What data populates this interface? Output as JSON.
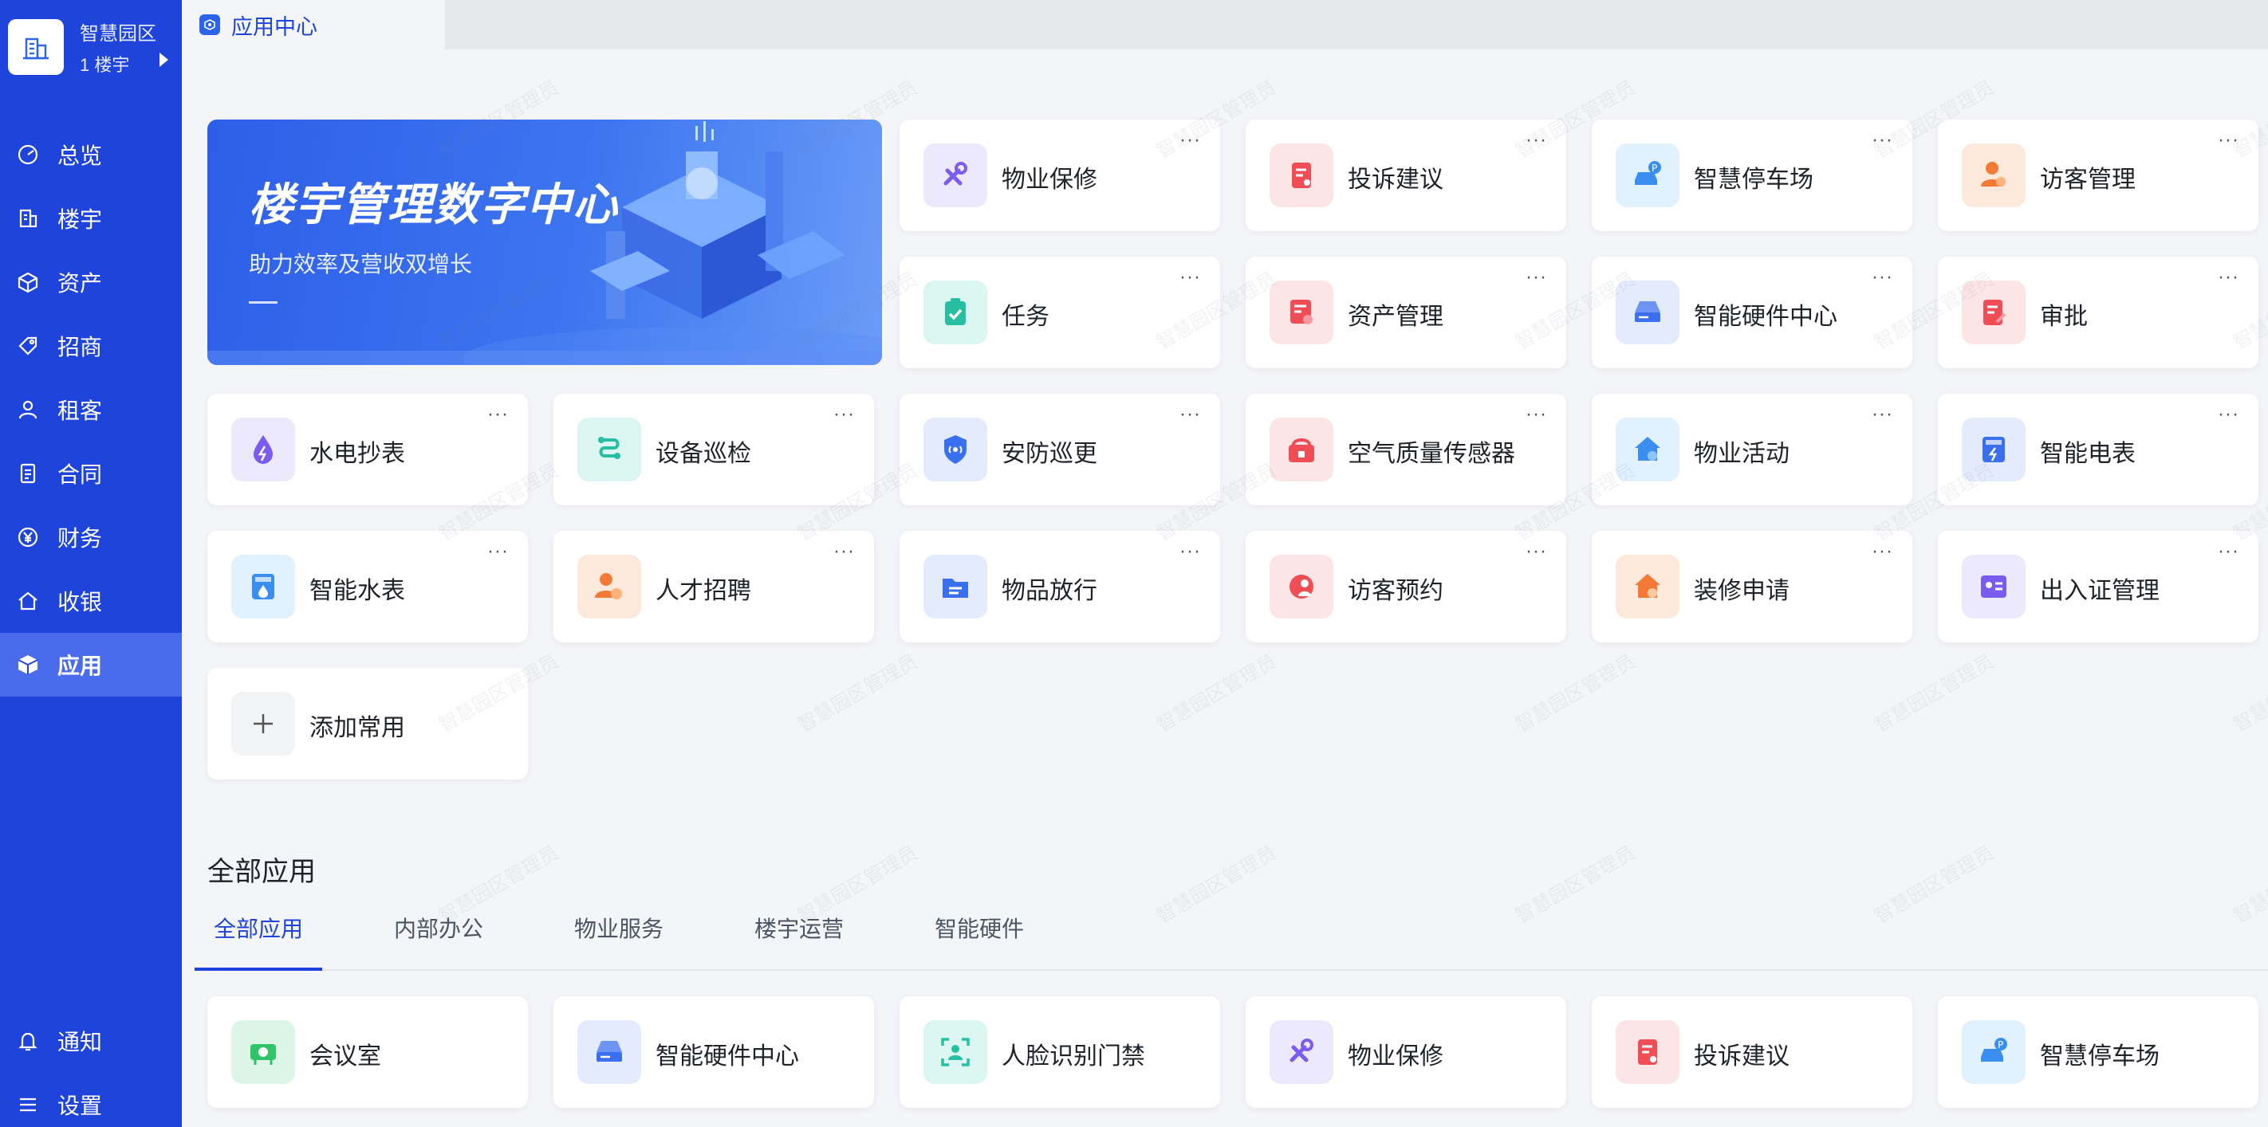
{
  "brand": {
    "name": "智慧园区",
    "sub": "1 楼宇"
  },
  "nav": [
    {
      "label": "总览",
      "icon": "dashboard-icon",
      "name": "nav-item-overview"
    },
    {
      "label": "楼宇",
      "icon": "building-icon",
      "name": "nav-item-building"
    },
    {
      "label": "资产",
      "icon": "cube-icon",
      "name": "nav-item-assets"
    },
    {
      "label": "招商",
      "icon": "tag-icon",
      "name": "nav-item-investment"
    },
    {
      "label": "租客",
      "icon": "user-icon",
      "name": "nav-item-tenants"
    },
    {
      "label": "合同",
      "icon": "document-icon",
      "name": "nav-item-contracts"
    },
    {
      "label": "财务",
      "icon": "yen-icon",
      "name": "nav-item-finance"
    },
    {
      "label": "收银",
      "icon": "home-icon",
      "name": "nav-item-cashier"
    },
    {
      "label": "应用",
      "icon": "box-icon",
      "name": "nav-item-apps",
      "active": true
    }
  ],
  "nav_bottom": [
    {
      "label": "通知",
      "icon": "bell-icon",
      "name": "nav-item-notifications"
    },
    {
      "label": "设置",
      "icon": "menu-icon",
      "name": "nav-item-settings"
    }
  ],
  "top_tab": {
    "label": "应用中心",
    "icon": "app-center-icon"
  },
  "banner": {
    "title": "楼宇管理数字中心",
    "subtitle": "助力效率及营收双增长"
  },
  "more_label": "···",
  "favorites": [
    {
      "label": "物业保修",
      "icon": "tools-icon",
      "bg": "#ece9fd",
      "fg": "#7b5cf0"
    },
    {
      "label": "投诉建议",
      "icon": "complaint-icon",
      "bg": "#fde5e6",
      "fg": "#ef4e57"
    },
    {
      "label": "智慧停车场",
      "icon": "parking-icon",
      "bg": "#e1f1fd",
      "fg": "#3a8eef"
    },
    {
      "label": "访客管理",
      "icon": "visitor-icon",
      "bg": "#fde9dc",
      "fg": "#f27a36"
    },
    {
      "label": "任务",
      "icon": "task-icon",
      "bg": "#dcf6f1",
      "fg": "#26bfa2"
    },
    {
      "label": "资产管理",
      "icon": "asset-icon",
      "bg": "#fde5e6",
      "fg": "#ef4e57"
    },
    {
      "label": "智能硬件中心",
      "icon": "hardware-icon",
      "bg": "#e3ebfd",
      "fg": "#3a6ff0"
    },
    {
      "label": "审批",
      "icon": "approval-icon",
      "bg": "#fde5e6",
      "fg": "#ef4e57"
    },
    {
      "label": "水电抄表",
      "icon": "water-electric-icon",
      "bg": "#ece9fd",
      "fg": "#7b5cf0"
    },
    {
      "label": "设备巡检",
      "icon": "inspection-icon",
      "bg": "#dcf6f1",
      "fg": "#26bfa2"
    },
    {
      "label": "安防巡更",
      "icon": "security-icon",
      "bg": "#e3ebfd",
      "fg": "#3a6ff0"
    },
    {
      "label": "空气质量传感器",
      "icon": "air-sensor-icon",
      "bg": "#fde5e6",
      "fg": "#ef4e57"
    },
    {
      "label": "物业活动",
      "icon": "activity-icon",
      "bg": "#e1f1fd",
      "fg": "#3a8eef"
    },
    {
      "label": "智能电表",
      "icon": "electric-meter-icon",
      "bg": "#e3ebfd",
      "fg": "#3a6ff0"
    },
    {
      "label": "智能水表",
      "icon": "water-meter-icon",
      "bg": "#e1f1fd",
      "fg": "#3a8eef"
    },
    {
      "label": "人才招聘",
      "icon": "recruit-icon",
      "bg": "#fde9dc",
      "fg": "#f27a36"
    },
    {
      "label": "物品放行",
      "icon": "release-icon",
      "bg": "#e3ebfd",
      "fg": "#3a6ff0"
    },
    {
      "label": "访客预约",
      "icon": "appointment-icon",
      "bg": "#fde5e6",
      "fg": "#ef4e57"
    },
    {
      "label": "装修申请",
      "icon": "renovation-icon",
      "bg": "#fde9dc",
      "fg": "#f27a36"
    },
    {
      "label": "出入证管理",
      "icon": "pass-icon",
      "bg": "#ece9fd",
      "fg": "#7b5cf0"
    }
  ],
  "add_favorite": {
    "label": "添加常用",
    "icon": "plus-icon"
  },
  "all_apps": {
    "title": "全部应用",
    "tabs": [
      "全部应用",
      "内部办公",
      "物业服务",
      "楼宇运营",
      "智能硬件"
    ],
    "items": [
      {
        "label": "会议室",
        "icon": "meeting-room-icon",
        "bg": "#dcf6e5",
        "fg": "#2fc36a"
      },
      {
        "label": "智能硬件中心",
        "icon": "hardware-icon",
        "bg": "#e3ebfd",
        "fg": "#3a6ff0"
      },
      {
        "label": "人脸识别门禁",
        "icon": "face-recognition-icon",
        "bg": "#dcf6f1",
        "fg": "#26bfa2"
      },
      {
        "label": "物业保修",
        "icon": "tools-icon",
        "bg": "#ece9fd",
        "fg": "#7b5cf0"
      },
      {
        "label": "投诉建议",
        "icon": "complaint-icon",
        "bg": "#fde5e6",
        "fg": "#ef4e57"
      },
      {
        "label": "智慧停车场",
        "icon": "parking-icon",
        "bg": "#e1f1fd",
        "fg": "#3a8eef"
      }
    ]
  },
  "watermark": "智慧园区管理员"
}
